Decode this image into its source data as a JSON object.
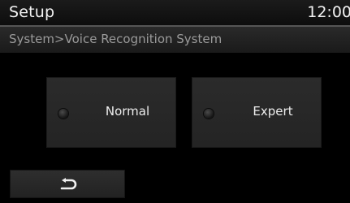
{
  "header": {
    "title": "Setup",
    "clock": "12:00"
  },
  "breadcrumb": "System>Voice Recognition System",
  "options": [
    {
      "label": "Normal",
      "selected": false
    },
    {
      "label": "Expert",
      "selected": false
    }
  ],
  "back_button": {
    "icon": "back-arrow-icon"
  }
}
